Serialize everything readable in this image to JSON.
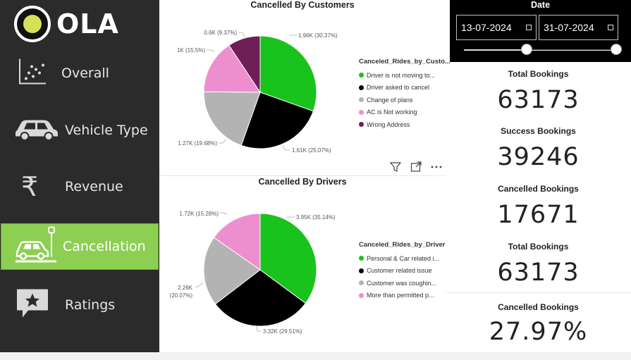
{
  "brand": {
    "name": "OLA"
  },
  "sidebar": {
    "items": [
      {
        "label": "Overall",
        "icon": "scatter-chart-icon",
        "active": false
      },
      {
        "label": "Vehicle Type",
        "icon": "car-icon",
        "active": false
      },
      {
        "label": "Revenue",
        "icon": "rupee-icon",
        "active": false
      },
      {
        "label": "Cancellation",
        "icon": "car-parking-icon",
        "active": true
      },
      {
        "label": "Ratings",
        "icon": "star-speech-bubble-icon",
        "active": false
      }
    ],
    "active_color": "#8ccf52"
  },
  "charts": {
    "customers": {
      "title": "Cancelled By Customers",
      "legend_title": "Canceled_Rides_by_Custo...",
      "legend_items": [
        "Driver is not moving to...",
        "Driver asked to cancel",
        "Change of plans",
        "AC is Not working",
        "Wrong Address"
      ],
      "data_labels": [
        "1.96K (30.37%)",
        "1.61K (25.07%)",
        "1.27K (19.68%)",
        "1K (15.5%)",
        "0.6K (9.37%)"
      ]
    },
    "drivers": {
      "title": "Cancelled By Drivers",
      "legend_title": "Canceled_Rides_by_Driver",
      "legend_items": [
        "Personal & Car related i...",
        "Customer related issue",
        "Customer was coughin...",
        "More than permitted p..."
      ],
      "data_labels": [
        "3.95K (35.14%)",
        "3.32K (29.51%)",
        "2.26K",
        "(20.07%)",
        "1.72K (15.28%)"
      ]
    }
  },
  "chart_data": [
    {
      "type": "pie",
      "title": "Cancelled By Customers",
      "legend_title": "Canceled_Rides_by_Custo...",
      "categories": [
        "Driver is not moving to...",
        "Driver asked to cancel",
        "Change of plans",
        "AC is Not working",
        "Wrong Address"
      ],
      "values": [
        1960,
        1610,
        1270,
        1000,
        600
      ],
      "percentages": [
        30.37,
        25.07,
        19.68,
        15.5,
        9.37
      ],
      "colors": [
        "#19c31c",
        "#000000",
        "#b3b3b3",
        "#ed8fcf",
        "#6e1f57"
      ],
      "legend_position": "right"
    },
    {
      "type": "pie",
      "title": "Cancelled By Drivers",
      "legend_title": "Canceled_Rides_by_Driver",
      "categories": [
        "Personal & Car related i...",
        "Customer related issue",
        "Customer was coughin...",
        "More than permitted p..."
      ],
      "values": [
        3950,
        3320,
        2260,
        1720
      ],
      "percentages": [
        35.14,
        29.51,
        20.07,
        15.28
      ],
      "colors": [
        "#19c31c",
        "#000000",
        "#b3b3b3",
        "#ed8fcf"
      ],
      "legend_position": "right"
    }
  ],
  "filters": {
    "date_label": "Date",
    "start_date": "13-07-2024",
    "end_date": "31-07-2024",
    "slider": {
      "start_fraction": 0.4,
      "end_fraction": 1.0
    }
  },
  "kpis": [
    {
      "label": "Total Bookings",
      "value": "63173"
    },
    {
      "label": "Success Bookings",
      "value": "39246"
    },
    {
      "label": "Cancelled Bookings",
      "value": "17671"
    },
    {
      "label": "Total Bookings",
      "value": "63173"
    },
    {
      "label": "Cancelled Bookings",
      "value": "27.97%"
    }
  ]
}
